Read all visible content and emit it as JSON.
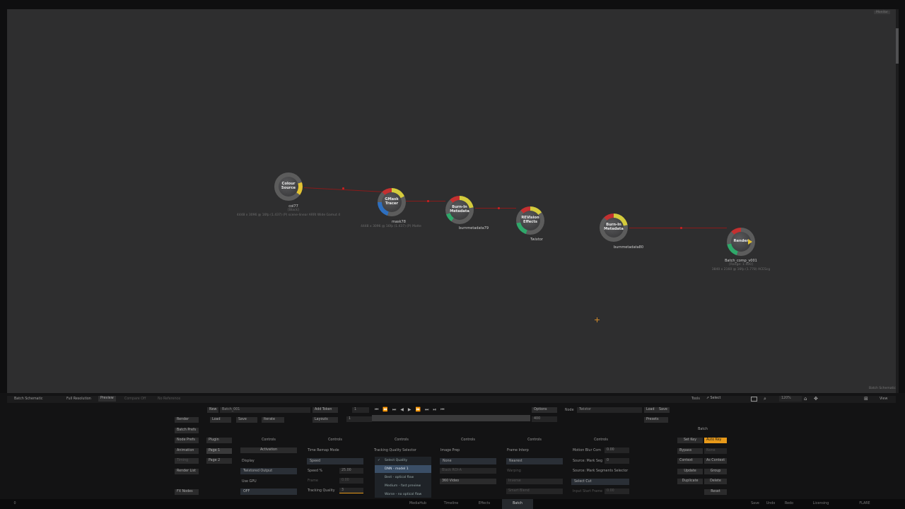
{
  "monitor_label": "Monitor",
  "schematic_label": "Batch Schematic",
  "nodes": [
    {
      "title": "Colour\nSource",
      "name": "col77",
      "sub1": "[Black]",
      "sub2": "4448 x 3096 @ 16fp (1.437) (P) scene-linear ARRI Wide Gamut 4"
    },
    {
      "title": "GMask\nTracer",
      "name": "mask78",
      "sub1": "4448 x 3096 @ 16fp (1.437) (P) Matte"
    },
    {
      "title": "Burn-In\nMetadata",
      "name": "burnmetadata79"
    },
    {
      "title": "REVision\nEffects",
      "name": "Twixtor"
    },
    {
      "title": "Burn-In\nMetadata",
      "name": "burnmetadata80"
    },
    {
      "title": "Render",
      "name": "Batch_comp_v001",
      "sub1": "[Range: 1-400]",
      "sub2": "3840 x 2160 @ 16fp (1.778) ACEScg"
    }
  ],
  "top_bar": {
    "schematic": "Batch Schematic",
    "resolution": "Full Resolution",
    "preview": "Preview",
    "compare": "Compare Off",
    "reference": "No Reference",
    "tools": "Tools",
    "select": "Select",
    "zoom": "120%"
  },
  "controls_row1": {
    "new": "New",
    "batch_name": "Batch_001",
    "add_token": "Add Token",
    "frame": "1",
    "options": "Options",
    "node_label": "Node",
    "node_name": "Twixtor",
    "load": "Load",
    "save": "Save"
  },
  "controls_row2": {
    "render": "Render",
    "load": "Load",
    "save": "Save",
    "iterate": "Iterate",
    "layouts": "Layouts",
    "range_start": "1",
    "range_end": "400",
    "presets": "Presets"
  },
  "left_buttons": [
    "Batch Prefs",
    "Node Prefs",
    "Animation",
    "Timing",
    "Render List",
    "FX Nodes"
  ],
  "pages": [
    "Plugin",
    "Page 1",
    "Page 2"
  ],
  "col1": {
    "header": "Controls",
    "activation": "Activation",
    "display": "Display",
    "twixtored": "Twixtored Output",
    "gpu": "Use GPU",
    "off": "OFF"
  },
  "col2": {
    "header": "Controls",
    "remap": "Time Remap Mode",
    "speed": "Speed",
    "speed_pct": "Speed %",
    "speed_val": "25.00",
    "frame": "Frame",
    "frame_val": "0.00",
    "quality": "Tracking Quality",
    "quality_val": "3"
  },
  "col3": {
    "header": "Controls",
    "selector": "Tracking Quality Selector",
    "options": [
      "Select Quality",
      "DNN - model 1",
      "Best - optical flow",
      "Medium - fast preview",
      "Worse - no optical flow"
    ]
  },
  "col4": {
    "header": "Controls",
    "prep": "Image Prep",
    "none": "None",
    "black": "Black ROI-A",
    "video": "360 Video"
  },
  "col5": {
    "header": "Controls",
    "interp": "Frame Interp",
    "nearest": "Nearest",
    "warping": "Warping",
    "inverse": "Inverse",
    "smart": "Smart Blend"
  },
  "col6": {
    "header": "Controls",
    "motion_blur": "Motion Blur Com",
    "mb_val": "0.00",
    "mark_seg": "Source: Mark Seg",
    "mark_val": "0",
    "mark_sel": "Source: Mark Segments Selector",
    "select_cut": "Select Cut",
    "input_start": "Input Start Frame",
    "input_val": "0.00"
  },
  "batch_panel": {
    "header": "Batch",
    "set_key": "Set Key",
    "auto_key": "Auto Key",
    "bypass": "Bypass",
    "none": "None",
    "context": "Context",
    "as_context": "As Context",
    "update": "Update",
    "group": "Group",
    "duplicate": "Duplicate",
    "delete": "Delete",
    "reset": "Reset"
  },
  "status": {
    "left": "0",
    "tabs": [
      "MediaHub",
      "Timeline",
      "Effects",
      "Batch"
    ],
    "active_tab": "Batch",
    "save": "Save",
    "undo": "Undo",
    "redo": "Redo",
    "licensing": "Licensing",
    "app": "FLARE"
  },
  "colors": {
    "accent": "#e89a1a",
    "link": "#8a1a1a"
  }
}
